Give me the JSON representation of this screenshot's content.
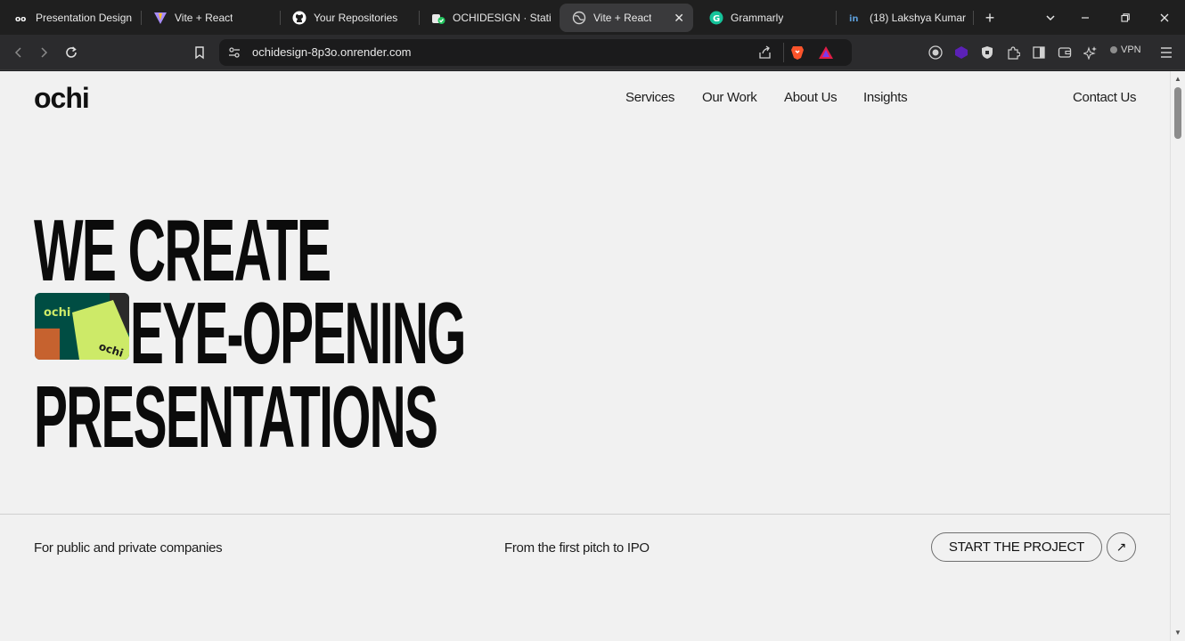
{
  "browser": {
    "tabs": [
      {
        "title": "Presentation Design",
        "favicon": "ochi-favicon",
        "active": false
      },
      {
        "title": "Vite + React",
        "favicon": "vite-icon",
        "active": false
      },
      {
        "title": "Your Repositories",
        "favicon": "github-icon",
        "active": false
      },
      {
        "title": "OCHIDESIGN · Static",
        "favicon": "render-icon",
        "active": false
      },
      {
        "title": "Vite + React",
        "favicon": "globe-icon",
        "active": true
      },
      {
        "title": "Grammarly",
        "favicon": "grammarly-icon",
        "active": false
      },
      {
        "title": "(18) Lakshya Kumar",
        "favicon": "linkedin-icon",
        "active": false
      }
    ],
    "close_tab_glyph": "✕",
    "new_tab_glyph": "+",
    "url": "ochidesign-8p3o.onrender.com",
    "vpn_label": "VPN"
  },
  "page": {
    "logo": "ochi",
    "nav": [
      "Services",
      "Our Work",
      "About Us",
      "Insights"
    ],
    "contact": "Contact Us",
    "hero": {
      "line1": "WE CREATE",
      "line2": "EYE-OPENING",
      "line3": "PRESENTATIONS",
      "image_logo_text": "ochi"
    },
    "footer": {
      "left": "For public and private companies",
      "middle": "From the first pitch to IPO",
      "cta": "START THE PROJECT",
      "cta_arrow": "↗"
    }
  },
  "colors": {
    "page_bg": "#f1f1f1",
    "text": "#0b0b0b",
    "accent_green": "#cdea68",
    "dark_green": "#004d43",
    "orange": "#c6622f"
  }
}
